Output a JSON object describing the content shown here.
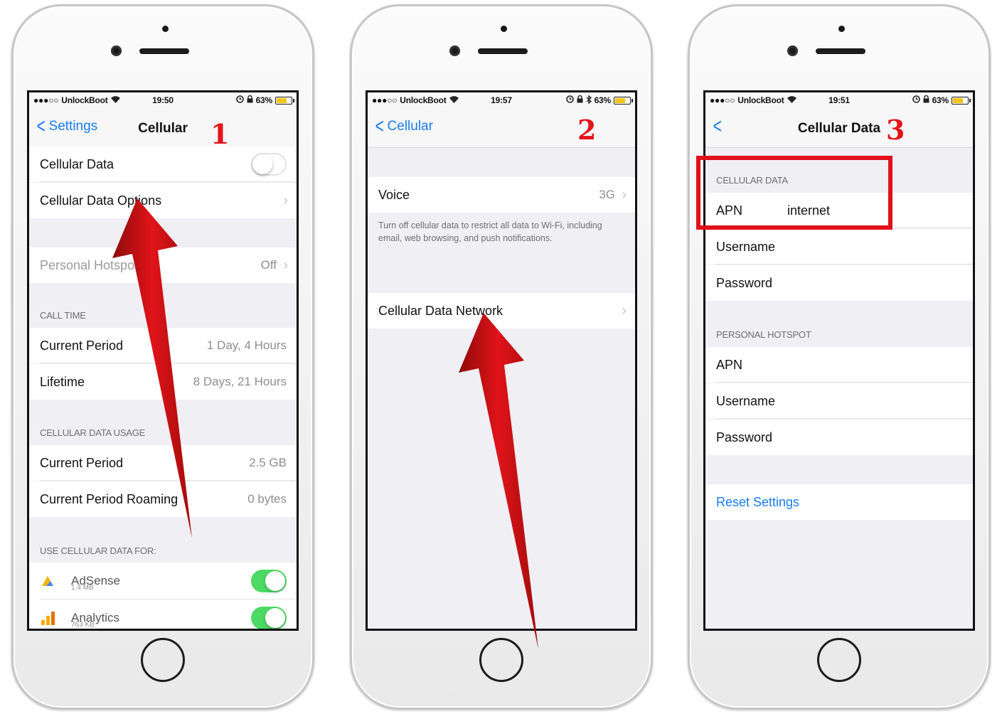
{
  "screens": [
    {
      "status": {
        "carrier": "UnlockBoot",
        "time": "19:50",
        "battery": "63%",
        "battery_level": 0.63
      },
      "nav": {
        "back_label": "Settings",
        "title": "Cellular"
      },
      "step": "1",
      "rows": {
        "cellular_data": "Cellular Data",
        "cellular_data_options": "Cellular Data Options",
        "personal_hotspot": "Personal Hotspot",
        "personal_hotspot_value": "Off",
        "call_time_header": "CALL TIME",
        "current_period": "Current Period",
        "current_period_value": "1 Day, 4 Hours",
        "lifetime": "Lifetime",
        "lifetime_value": "8 Days, 21 Hours",
        "usage_header": "CELLULAR DATA USAGE",
        "usage_current_period": "Current Period",
        "usage_current_period_value": "2.5 GB",
        "usage_roaming": "Current Period Roaming",
        "usage_roaming_value": "0 bytes",
        "use_for_header": "USE CELLULAR DATA FOR:"
      },
      "apps": [
        {
          "name": "AdSense",
          "size": "1.4 MB"
        },
        {
          "name": "Analytics",
          "size": "763 KB"
        }
      ]
    },
    {
      "status": {
        "carrier": "UnlockBoot",
        "time": "19:57",
        "battery": "63%",
        "battery_level": 0.63
      },
      "nav": {
        "back_label": "Cellular"
      },
      "step": "2",
      "rows": {
        "voice": "Voice",
        "voice_value": "3G",
        "note": "Turn off cellular data to restrict all data to Wi-Fi, including email, web browsing, and push notifications.",
        "network": "Cellular Data Network"
      }
    },
    {
      "status": {
        "carrier": "UnlockBoot",
        "time": "19:51",
        "battery": "63%",
        "battery_level": 0.63
      },
      "nav": {
        "title": "Cellular Data"
      },
      "step": "3",
      "rows": {
        "cellular_header": "CELLULAR DATA",
        "apn": "APN",
        "apn_value": "internet",
        "username": "Username",
        "password": "Password",
        "hotspot_header": "PERSONAL HOTSPOT",
        "hotspot_apn": "APN",
        "hotspot_username": "Username",
        "hotspot_password": "Password",
        "reset": "Reset Settings"
      }
    }
  ],
  "colors": {
    "accent": "#1a7cf0",
    "annotation": "#e0101a",
    "toggle_on": "#4cd964",
    "group_bg": "#efeff4"
  },
  "icons": [
    "wifi-icon",
    "alarm-icon",
    "lock-icon",
    "bluetooth-icon",
    "battery-icon",
    "chevron-left-icon",
    "chevron-right-icon",
    "adsense-icon",
    "analytics-icon"
  ]
}
